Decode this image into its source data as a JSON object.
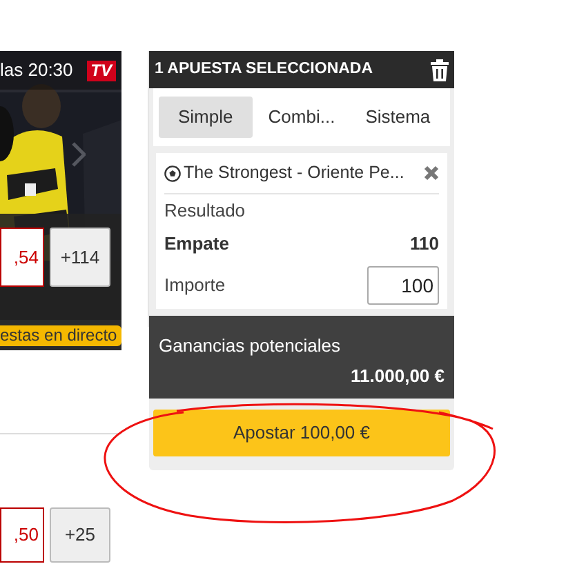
{
  "live_event": {
    "time_label": "las 20:30",
    "tv_badge": "TV",
    "odds_button": ",54",
    "more_markets_button": "+114",
    "live_badge": "estas en directo"
  },
  "second_event": {
    "odds_button": ",50",
    "more_markets_button": "+25"
  },
  "betslip": {
    "title": "1 APUESTA SELECCIONADA",
    "tabs": [
      {
        "label": "Simple",
        "selected": true
      },
      {
        "label": "Combi...",
        "selected": false
      },
      {
        "label": "Sistema",
        "selected": false
      }
    ],
    "bet": {
      "event": "The Strongest - Oriente Pe...",
      "market": "Resultado",
      "selection": "Empate",
      "odds": "110",
      "stake_label": "Importe",
      "stake_value": "100"
    },
    "potential_winnings": {
      "label": "Ganancias potenciales",
      "amount": "11.000,00 €"
    },
    "place_bet_button": "Apostar 100,00 €"
  }
}
